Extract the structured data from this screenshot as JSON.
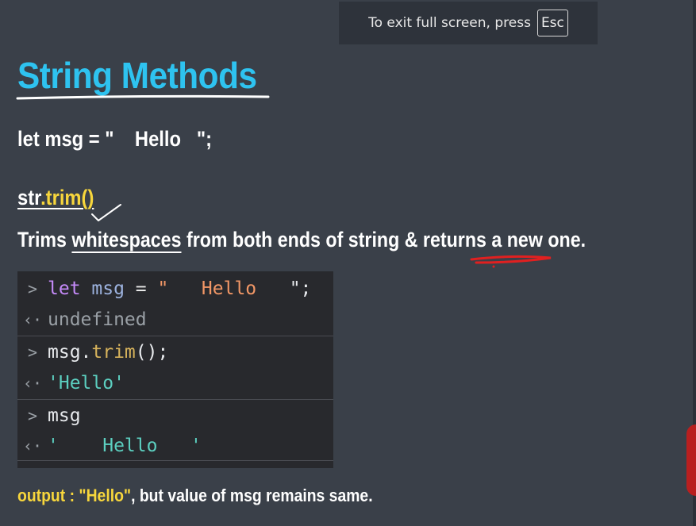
{
  "fullscreen_banner": {
    "text": "To exit full screen, press",
    "key": "Esc"
  },
  "title": "String Methods",
  "code_line": "let msg = \"    Hello   \";",
  "method_heading": {
    "object": "str",
    "method": ".trim()"
  },
  "description": {
    "part1": "Trims ",
    "underlined1": "whitespaces",
    "part2": " from both ends of string & returns a new one."
  },
  "console": {
    "rows": [
      {
        "arrow": ">",
        "kw": "let",
        "var": "msg",
        "op": " = ",
        "str_open": "\"",
        "str_body": "   Hello   ",
        "str_close": "\";"
      },
      {
        "arrow": "‹·",
        "text": "undefined"
      },
      {
        "arrow": ">",
        "obj": "msg.",
        "fn": "trim",
        "rest": "();"
      },
      {
        "arrow": "‹·",
        "text": "'Hello'"
      },
      {
        "arrow": ">",
        "text": "msg"
      },
      {
        "arrow": "‹·",
        "text": "'    Hello   '"
      }
    ]
  },
  "output": {
    "label": "output : \"Hello\"",
    "rest": ", but value of msg remains same."
  },
  "colors": {
    "title": "#2ec3f0",
    "highlight": "#f7d63c",
    "background": "#3a4049",
    "console_bg": "#28292d"
  }
}
